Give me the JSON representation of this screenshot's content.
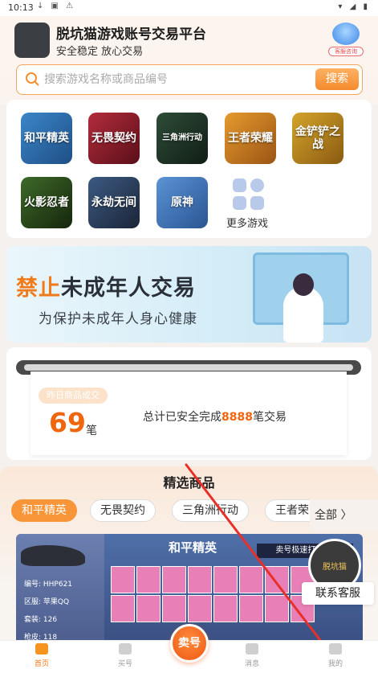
{
  "status_bar": {
    "time": "10:13",
    "left_icons": "↓ ▣ ⚠",
    "right_icons": "▾ ◢ ▮"
  },
  "header": {
    "logo_text": "脱坑猫",
    "title": "脱坑猫游戏账号交易平台",
    "subtitle": "安全稳定 放心交易",
    "cs_label": "客服咨询"
  },
  "search": {
    "placeholder": "搜索游戏名称或商品编号",
    "value": "",
    "button": "搜索"
  },
  "games": [
    {
      "name": "和平精英",
      "color": "#2b6aa8"
    },
    {
      "name": "无畏契约",
      "color": "#8a1f2b"
    },
    {
      "name": "三角洲行动",
      "color": "#1e3a2a"
    },
    {
      "name": "王者荣耀",
      "color": "#c47a1a"
    },
    {
      "name": "金铲铲之战",
      "color": "#b78a1f"
    },
    {
      "name": "火影忍者",
      "color": "#2a4a1c"
    },
    {
      "name": "永劫无间",
      "color": "#2c3f5c"
    },
    {
      "name": "原神",
      "color": "#3f71b0"
    }
  ],
  "more_games": "更多游戏",
  "banner": {
    "title_orange": "禁止",
    "title_dark": "未成年人交易",
    "subtitle": "为保护未成年人身心健康"
  },
  "stats": {
    "tag": "昨日商品成交",
    "count": "69",
    "unit": "笔",
    "total_prefix": "总计已安全完成",
    "total_value": "8888",
    "total_suffix": "笔交易"
  },
  "featured": {
    "title": "精选商品",
    "tabs": [
      "和平精英",
      "无畏契约",
      "三角洲行动",
      "王者荣"
    ],
    "all_label": "全部 〉"
  },
  "product": {
    "game_title": "和平精英",
    "badge": "卖号极速打款 买",
    "info": [
      "编号: HHP621",
      "区服: 苹果QQ",
      "套装: 126",
      "枪皮: 118"
    ]
  },
  "contact_cs": "联系客服",
  "tabbar": {
    "home": "首页",
    "buy": "买号",
    "sell": "卖号",
    "message": "消息",
    "mine": "我的"
  }
}
